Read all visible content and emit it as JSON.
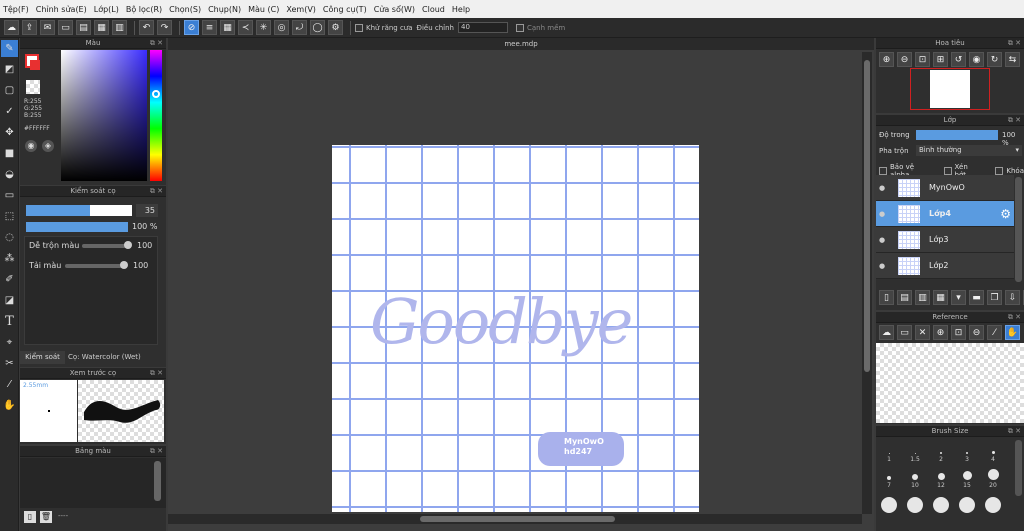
{
  "menu": [
    "Tệp(F)",
    "Chỉnh sửa(E)",
    "Lớp(L)",
    "Bộ lọc(R)",
    "Chọn(S)",
    "Chụp(N)",
    "Màu (C)",
    "Xem(V)",
    "Công cụ(T)",
    "Cửa sổ(W)",
    "Cloud",
    "Help"
  ],
  "toolbar": {
    "antialias_label": "Khử răng cưa",
    "adjust_label": "Điều chỉnh",
    "adjust_value": "40",
    "soft_edge_label": "Cạnh mềm"
  },
  "color_panel": {
    "title": "Màu",
    "r": "R:255",
    "g": "G:255",
    "b": "B:255",
    "hex": "#FFFFFF",
    "fg_color": "#ffffff",
    "bg_color": "#e83030"
  },
  "brush_control": {
    "title": "Kiểm soát cọ",
    "size_value": "35",
    "opacity_value": "100 %",
    "blend_label": "Dễ trộn màu",
    "blend_value": "100",
    "reload_label": "Tải màu",
    "reload_value": "100",
    "tab_label": "Kiểm soát cọ",
    "brush_name": "Cọ: Watercolor (Wet)"
  },
  "brush_preview": {
    "title": "Xem trước cọ",
    "size": "2.55mm"
  },
  "palette": {
    "title": "Bảng màu",
    "footer": "----"
  },
  "document": {
    "title": "mee.mdp",
    "art_text": "Goodbye",
    "sticker_line1": "MynOwO",
    "sticker_line2": "hd247"
  },
  "navigator": {
    "title": "Hoa tiêu"
  },
  "layer_panel": {
    "title": "Lớp",
    "opacity_label": "Độ trong",
    "opacity_value": "100 %",
    "blend_label": "Pha trộn",
    "blend_value": "Bình thường",
    "protect_alpha": "Bảo vệ alpha",
    "clipping": "Xén bớt",
    "lock": "Khóa",
    "layers": [
      {
        "name": "MynOwO"
      },
      {
        "name": "Lớp4"
      },
      {
        "name": "Lớp3"
      },
      {
        "name": "Lớp2"
      }
    ]
  },
  "reference_panel": {
    "title": "Reference"
  },
  "brush_size_panel": {
    "title": "Brush Size",
    "sizes": [
      "1",
      "1.5",
      "2",
      "3",
      "4",
      "7",
      "10",
      "12",
      "15",
      "20",
      "",
      "",
      "",
      "",
      ""
    ]
  }
}
